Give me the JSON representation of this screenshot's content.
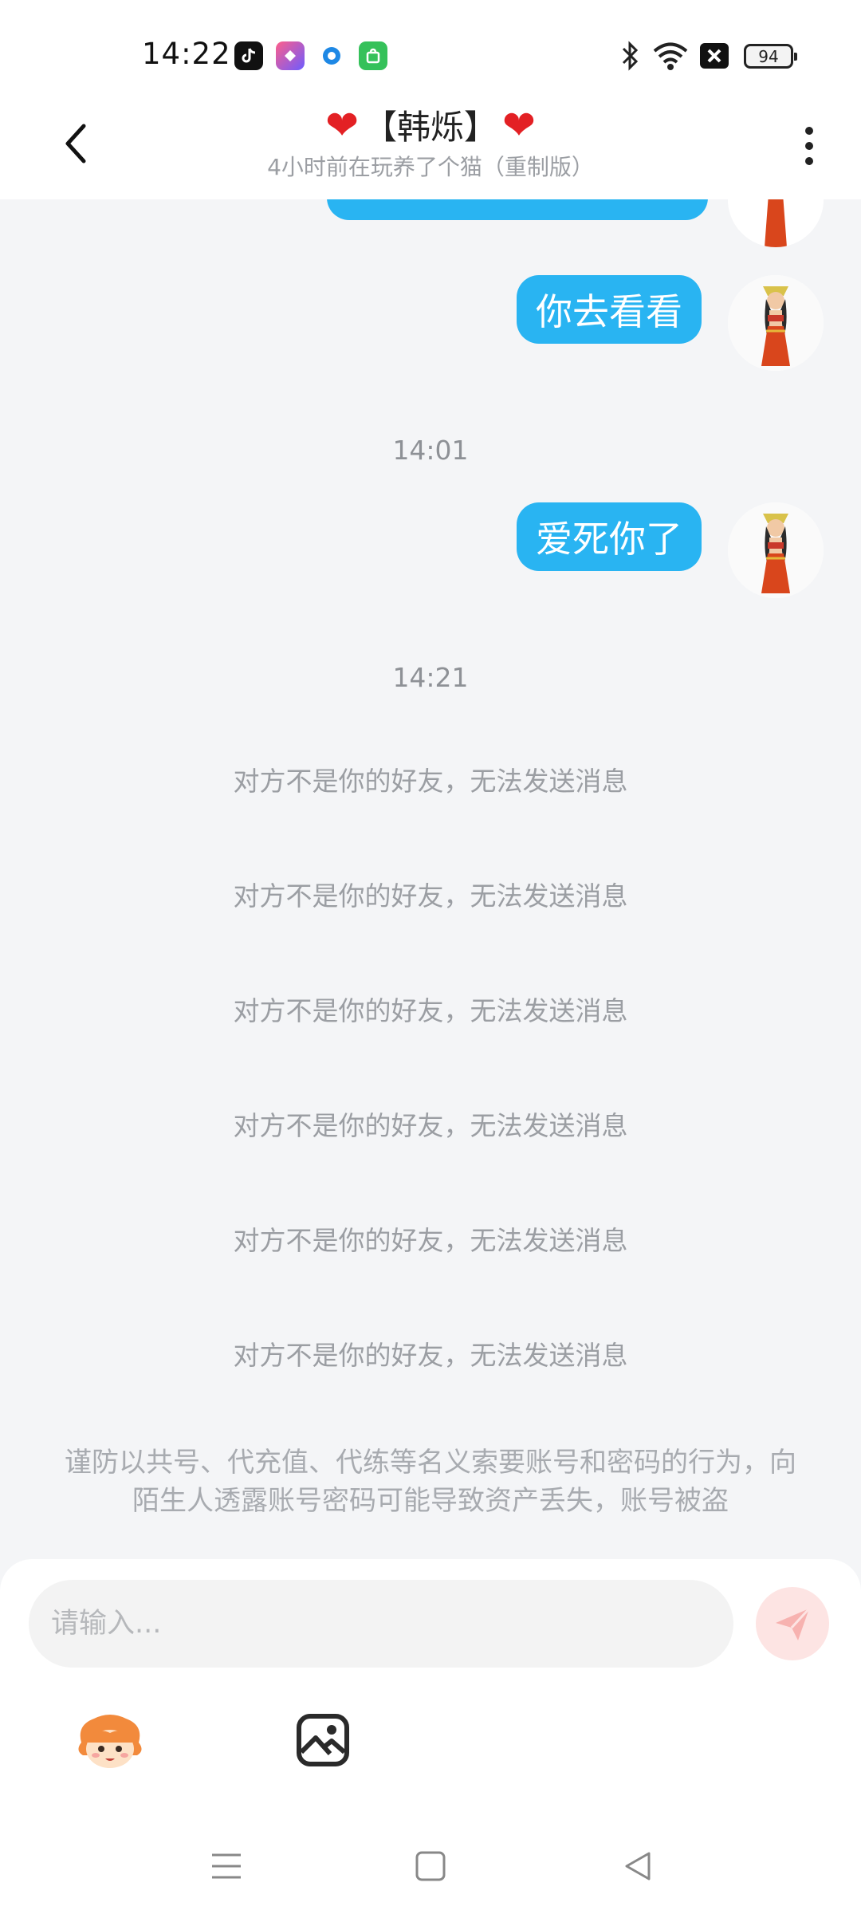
{
  "status_bar": {
    "time": "14:22",
    "apps": [
      "tiktok-icon",
      "shortcut-app-icon",
      "browser-app-icon",
      "store-app-icon"
    ],
    "battery": "94"
  },
  "header": {
    "title": "【韩烁】",
    "heart_left": "❤",
    "heart_right": "❤",
    "subtitle": "4小时前在玩养了个猫（重制版）"
  },
  "messages": [
    {
      "type": "sent",
      "text": "你去看看"
    },
    {
      "type": "timestamp",
      "text": "14:01"
    },
    {
      "type": "sent",
      "text": "爱死你了"
    },
    {
      "type": "timestamp",
      "text": "14:21"
    }
  ],
  "system_messages": [
    "对方不是你的好友，无法发送消息",
    "对方不是你的好友，无法发送消息",
    "对方不是你的好友，无法发送消息",
    "对方不是你的好友，无法发送消息",
    "对方不是你的好友，无法发送消息",
    "对方不是你的好友，无法发送消息"
  ],
  "warning": "谨防以共号、代充值、代练等名义索要账号和密码的行为，向陌生人透露账号密码可能导致资产丢失，账号被盗",
  "input": {
    "placeholder": "请输入...",
    "value": ""
  },
  "colors": {
    "bubble": "#29b4f2",
    "heart": "#e32024",
    "send_button_bg": "#fde4e3",
    "send_button_icon": "#f7b2b0",
    "background": "#f4f5f7"
  },
  "icons": {
    "back": "chevron-left-icon",
    "more": "more-vertical-icon",
    "send": "send-icon",
    "emoji": "mascot-emoji-icon",
    "image": "image-icon",
    "nav_menu": "menu-icon",
    "nav_home": "home-square-icon",
    "nav_back": "back-triangle-icon"
  }
}
